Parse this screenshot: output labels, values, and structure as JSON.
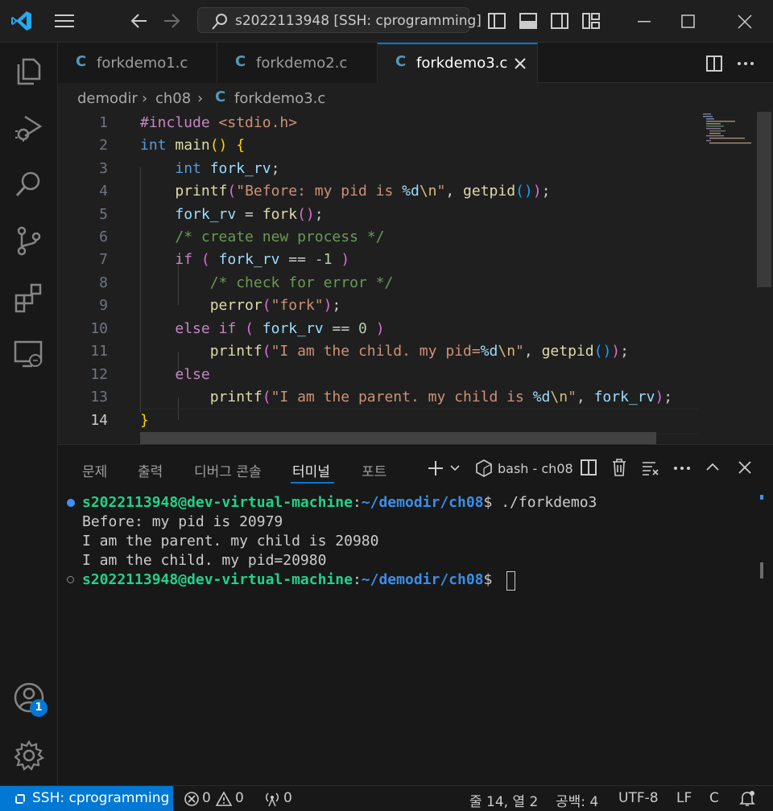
{
  "titlebar": {
    "search_text": "s2022113948 [SSH: cprogramming]"
  },
  "tabs": [
    {
      "label": "forkdemo1.c"
    },
    {
      "label": "forkdemo2.c"
    },
    {
      "label": "forkdemo3.c"
    }
  ],
  "breadcrumb": {
    "folder": "demodir",
    "subfolder": "ch08",
    "file": "forkdemo3.c"
  },
  "editor": {
    "line_numbers": [
      "1",
      "2",
      "3",
      "4",
      "5",
      "6",
      "7",
      "8",
      "9",
      "10",
      "11",
      "12",
      "13",
      "14"
    ]
  },
  "panel": {
    "tabs": [
      "문제",
      "출력",
      "디버그 콘솔",
      "터미널",
      "포트"
    ],
    "terminal_name": "bash - ch08",
    "user_host": "s2022113948@dev-virtual-machine",
    "path": "~/demodir/ch08",
    "command": "$ ./forkdemo3",
    "output": [
      "Before: my pid is 20979",
      "I am the parent. my child is 20980",
      "I am the child. my pid=20980"
    ],
    "prompt_end": "$ "
  },
  "activity": {
    "account_badge": "1"
  },
  "statusbar": {
    "remote": "SSH: cprogramming",
    "errors": "0",
    "warnings": "0",
    "ports": "0",
    "position": "줄 14, 열 2",
    "spaces": "공백: 4",
    "encoding": "UTF-8",
    "eol": "LF",
    "language": "C"
  },
  "colors": {
    "accent": "#0078d4",
    "remote_bg": "#0078d4",
    "badge": "#0078d4"
  }
}
